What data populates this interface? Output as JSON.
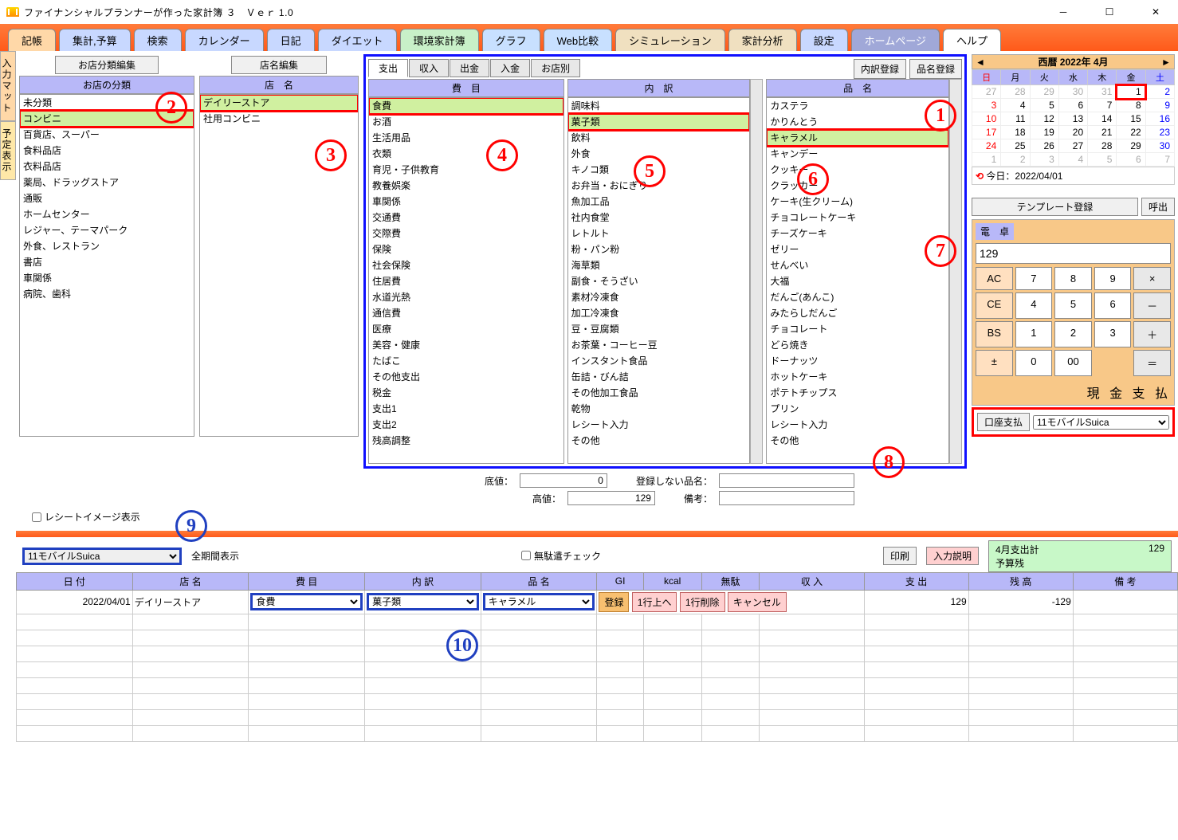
{
  "window": {
    "title": "ファイナンシャルプランナーが作った家計簿 ３　Ｖｅｒ 1.0"
  },
  "tabs": [
    "記帳",
    "集計,予算",
    "検索",
    "カレンダー",
    "日記",
    "ダイエット",
    "環境家計簿",
    "グラフ",
    "Web比較",
    "シミュレーション",
    "家計分析",
    "設定",
    "ホームページ",
    "ヘルプ"
  ],
  "sidetabs": [
    "入力マット",
    "予定表示"
  ],
  "buttons": {
    "store_cat_edit": "お店分類編集",
    "store_name_edit": "店名編集",
    "detail_reg": "内訳登録",
    "item_reg": "品名登録",
    "tmpl_reg": "テンプレート登録",
    "call": "呼出",
    "cash_pay": "現 金 支 払",
    "acct_pay": "口座支払",
    "print": "印刷",
    "input_help": "入力説明"
  },
  "headers": {
    "store_cat": "お店の分類",
    "store_name": "店　名",
    "expense": "費　目",
    "detail": "内　訳",
    "item": "品　名"
  },
  "sub_tabs": [
    "支出",
    "収入",
    "出金",
    "入金",
    "お店別"
  ],
  "store_cats": [
    "未分類",
    "コンビニ",
    "百貨店、スーパー",
    "食料品店",
    "衣料品店",
    "薬局、ドラッグストア",
    "通販",
    "ホームセンター",
    "レジャー、テーマパーク",
    "外食、レストラン",
    "書店",
    "車関係",
    "病院、歯科"
  ],
  "store_names": [
    "デイリーストア",
    "社用コンビニ"
  ],
  "expenses": [
    "食費",
    "お酒",
    "生活用品",
    "衣類",
    "育児・子供教育",
    "教養娯楽",
    "車関係",
    "交通費",
    "交際費",
    "保険",
    "社会保険",
    "住居費",
    "水道光熱",
    "通信費",
    "医療",
    "美容・健康",
    "たばこ",
    "その他支出",
    "税金",
    "支出1",
    "支出2",
    "残高調整"
  ],
  "details": [
    "調味料",
    "菓子類",
    "飲料",
    "外食",
    "キノコ類",
    "お弁当・おにぎり",
    "魚加工品",
    "社内食堂",
    "レトルト",
    "粉・パン粉",
    "海草類",
    "副食・そうざい",
    "素材冷凍食",
    "加工冷凍食",
    "豆・豆腐類",
    "お茶葉・コーヒー豆",
    "インスタント食品",
    "缶詰・びん詰",
    "その他加工食品",
    "乾物",
    "レシート入力",
    "その他"
  ],
  "items": [
    "カステラ",
    "かりんとう",
    "キャラメル",
    "キャンデー",
    "クッキー",
    "クラッカー",
    "ケーキ(生クリーム)",
    "チョコレートケーキ",
    "チーズケーキ",
    "ゼリー",
    "せんべい",
    "大福",
    "だんご(あんこ)",
    "みたらしだんご",
    "チョコレート",
    "どら焼き",
    "ドーナッツ",
    "ホットケーキ",
    "ポテトチップス",
    "プリン",
    "レシート入力",
    "その他"
  ],
  "price": {
    "low_lbl": "底値：",
    "low": "0",
    "high_lbl": "高値：",
    "high": "129",
    "noreg_lbl": "登録しない品名：",
    "noreg": "",
    "note_lbl": "備考：",
    "note": ""
  },
  "receipt_chk": "レシートイメージ表示",
  "waste_chk": "無駄遣チェック",
  "period": "全期間表示",
  "account_sel": "11モバイルSuica",
  "calendar": {
    "title": "西暦 2022年 4月",
    "days": [
      "日",
      "月",
      "火",
      "水",
      "木",
      "金",
      "土"
    ],
    "rows": [
      [
        "27",
        "28",
        "29",
        "30",
        "31",
        "1",
        "2"
      ],
      [
        "3",
        "4",
        "5",
        "6",
        "7",
        "8",
        "9"
      ],
      [
        "10",
        "11",
        "12",
        "13",
        "14",
        "15",
        "16"
      ],
      [
        "17",
        "18",
        "19",
        "20",
        "21",
        "22",
        "23"
      ],
      [
        "24",
        "25",
        "26",
        "27",
        "28",
        "29",
        "30"
      ],
      [
        "1",
        "2",
        "3",
        "4",
        "5",
        "6",
        "7"
      ]
    ],
    "today_lbl": "今日：2022/04/01"
  },
  "calc": {
    "label": "電　卓",
    "display": "129",
    "keys": [
      [
        "AC",
        "7",
        "8",
        "9",
        "×"
      ],
      [
        "CE",
        "4",
        "5",
        "6",
        "－"
      ],
      [
        "BS",
        "1",
        "2",
        "3",
        "＋"
      ],
      [
        "±",
        "0",
        "00",
        "",
        "＝"
      ]
    ]
  },
  "summary": {
    "label": "4月支出計",
    "value": "129",
    "budget": "予算残"
  },
  "grid": {
    "headers": [
      "日 付",
      "店 名",
      "費 目",
      "内 訳",
      "品 名",
      "GI",
      "kcal",
      "無駄",
      "収 入",
      "支 出",
      "残 高",
      "備 考"
    ],
    "row": {
      "date": "2022/04/01",
      "store": "デイリーストア",
      "expense": "食費",
      "detail": "菓子類",
      "item": "キャラメル",
      "out": "129",
      "bal": "-129"
    },
    "btns": [
      "登録",
      "1行上へ",
      "1行削除",
      "キャンセル"
    ]
  }
}
